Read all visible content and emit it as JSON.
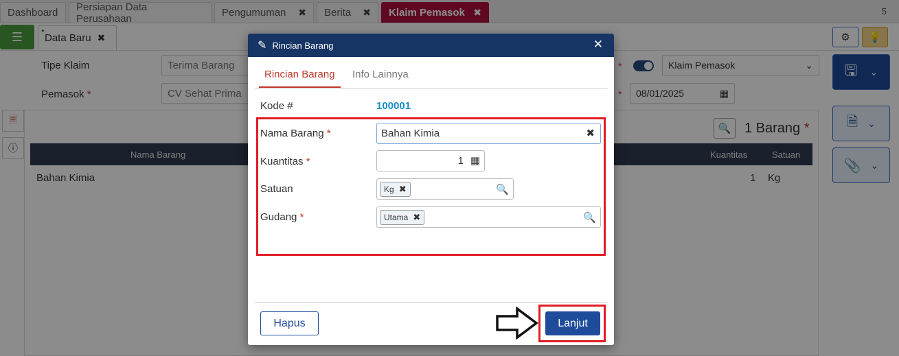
{
  "tabs": [
    {
      "label": "Dashboard",
      "closable": false,
      "active": false
    },
    {
      "label": "Persiapan Data Perusahaan",
      "closable": false,
      "active": false
    },
    {
      "label": "Pengumuman",
      "closable": true,
      "active": false
    },
    {
      "label": "Berita",
      "closable": true,
      "active": false
    },
    {
      "label": "Klaim Pemasok",
      "closable": true,
      "active": true
    }
  ],
  "tab_count": "5",
  "subtab": {
    "star": "*",
    "label": "Data Baru"
  },
  "form": {
    "tipe_klaim_label": "Tipe Klaim",
    "tipe_klaim_value": "Terima Barang",
    "pemasok_label": "Pemasok",
    "pemasok_value": "CV Sehat Prima",
    "req_mark": "*",
    "jenis_value": "Klaim Pemasok",
    "date_value": "08/01/2025"
  },
  "items_summary": "1 Barang",
  "table": {
    "headers": [
      "Nama Barang",
      "Kuantitas",
      "Satuan"
    ],
    "rows": [
      {
        "nama": "Bahan Kimia",
        "kuantitas": "1",
        "satuan": "Kg"
      }
    ]
  },
  "modal": {
    "title": "Rincian Barang",
    "tabs": [
      "Rincian Barang",
      "Info Lainnya"
    ],
    "kode_label": "Kode #",
    "kode_value": "100001",
    "nama_label": "Nama Barang",
    "nama_value": "Bahan Kimia",
    "kuantitas_label": "Kuantitas",
    "kuantitas_value": "1",
    "satuan_label": "Satuan",
    "satuan_tag": "Kg",
    "gudang_label": "Gudang",
    "gudang_tag": "Utama",
    "hapus_label": "Hapus",
    "lanjut_label": "Lanjut"
  },
  "colors": {
    "active_tab": "#b0103f",
    "modal_header": "#163464",
    "primary": "#1e4b9a",
    "highlight": "#e01c24",
    "link": "#1a8fc9"
  }
}
